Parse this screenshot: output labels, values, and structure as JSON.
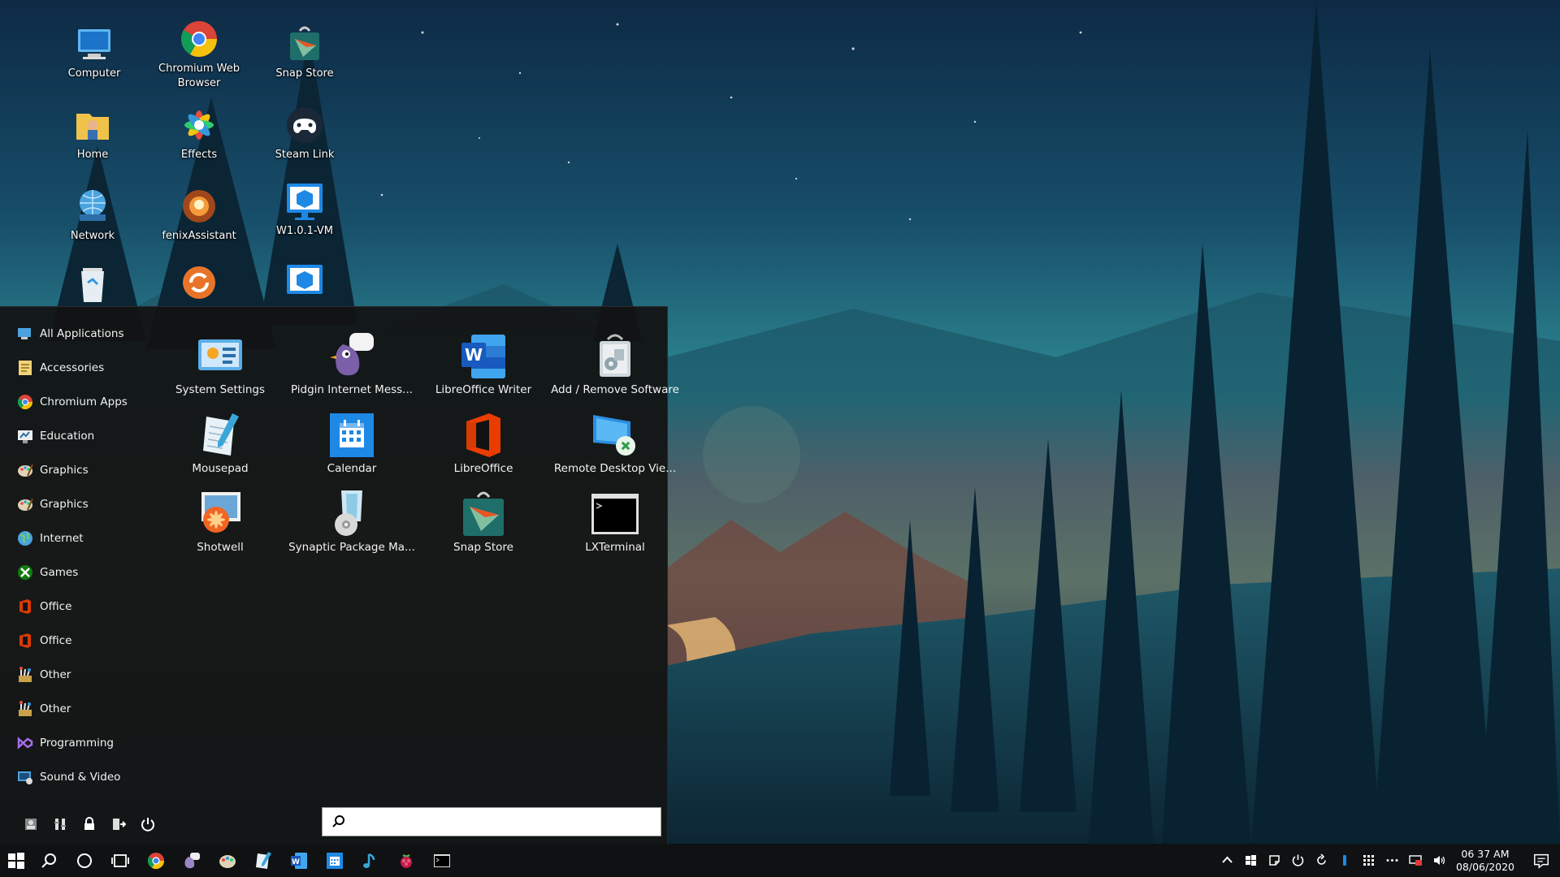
{
  "desktop": {
    "icons": [
      {
        "label": "Computer",
        "icon": "computer-icon"
      },
      {
        "label": "Chromium Web Browser",
        "icon": "chromium-icon"
      },
      {
        "label": "Snap Store",
        "icon": "snap-store-icon"
      },
      {
        "label": "Home",
        "icon": "home-folder-icon"
      },
      {
        "label": "Effects",
        "icon": "effects-icon"
      },
      {
        "label": "Steam Link",
        "icon": "steam-link-icon"
      },
      {
        "label": "Network",
        "icon": "network-icon"
      },
      {
        "label": "fenixAssistant",
        "icon": "fenix-assistant-icon"
      },
      {
        "label": "W1.0.1-VM",
        "icon": "vm-icon"
      }
    ]
  },
  "start_menu": {
    "categories": [
      {
        "label": "All Applications",
        "icon": "all-applications-icon"
      },
      {
        "label": "Accessories",
        "icon": "accessories-icon"
      },
      {
        "label": "Chromium Apps",
        "icon": "chromium-icon"
      },
      {
        "label": "Education",
        "icon": "education-icon"
      },
      {
        "label": "Graphics",
        "icon": "graphics-icon"
      },
      {
        "label": "Graphics",
        "icon": "graphics-icon"
      },
      {
        "label": "Internet",
        "icon": "internet-icon"
      },
      {
        "label": "Games",
        "icon": "games-icon"
      },
      {
        "label": "Office",
        "icon": "office-icon"
      },
      {
        "label": "Office",
        "icon": "office-icon"
      },
      {
        "label": "Other",
        "icon": "other-icon"
      },
      {
        "label": "Other",
        "icon": "other-icon"
      },
      {
        "label": "Programming",
        "icon": "programming-icon"
      },
      {
        "label": "Sound & Video",
        "icon": "sound-video-icon"
      }
    ],
    "apps": [
      {
        "label": "System Settings",
        "icon": "system-settings-icon"
      },
      {
        "label": "Pidgin Internet Mess...",
        "icon": "pidgin-icon"
      },
      {
        "label": "LibreOffice Writer",
        "icon": "word-icon"
      },
      {
        "label": "Add / Remove Software",
        "icon": "add-remove-software-icon"
      },
      {
        "label": "Mousepad",
        "icon": "mousepad-icon"
      },
      {
        "label": "Calendar",
        "icon": "calendar-icon"
      },
      {
        "label": "LibreOffice",
        "icon": "office-icon"
      },
      {
        "label": "Remote Desktop Vie...",
        "icon": "remote-desktop-icon"
      },
      {
        "label": "Shotwell",
        "icon": "shotwell-icon"
      },
      {
        "label": "Synaptic Package Ma...",
        "icon": "synaptic-icon"
      },
      {
        "label": "Snap Store",
        "icon": "snap-store-icon"
      },
      {
        "label": "LXTerminal",
        "icon": "terminal-icon"
      }
    ],
    "footer": [
      "user-icon",
      "settings-icon",
      "lock-icon",
      "logout-icon",
      "power-icon"
    ],
    "search": {
      "value": "",
      "placeholder": ""
    }
  },
  "taskbar": {
    "pinned": [
      "start-icon",
      "search-icon",
      "cortana-icon",
      "task-view-icon",
      "chromium-icon",
      "pidgin-icon",
      "graphics-icon",
      "mousepad-icon",
      "word-icon",
      "calendar-icon",
      "music-icon",
      "raspberry-icon",
      "terminal-icon"
    ],
    "tray": [
      "chevron-up-icon",
      "windows-icon",
      "note-icon",
      "power-icon",
      "refresh-icon",
      "bluetooth-icon",
      "grid-icon",
      "more-icon",
      "display-icon",
      "volume-icon"
    ],
    "clock": {
      "time": "06 37 AM",
      "date": "08/06/2020"
    }
  },
  "colors": {
    "accent": "#1e88e5",
    "panel": "#121212",
    "taskbar": "#0f1113"
  }
}
